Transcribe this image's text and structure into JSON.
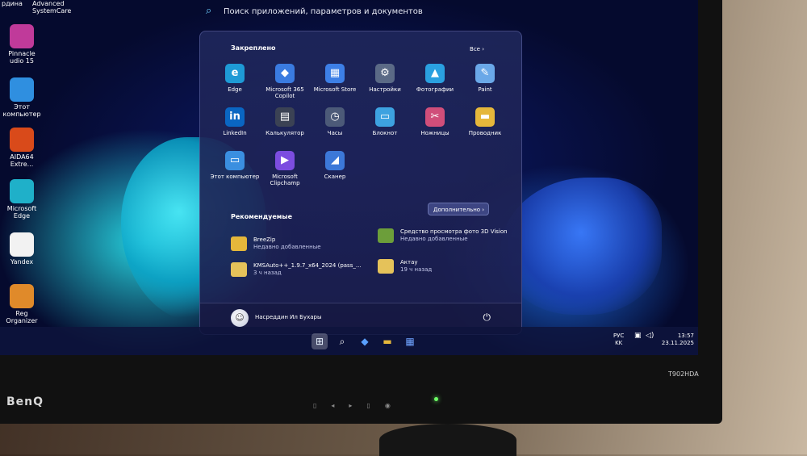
{
  "desktop": {
    "top_labels": [
      "рдина",
      "Advanced",
      "SystemCare"
    ],
    "icons": [
      {
        "label": "Pinnacle\nudio 15",
        "icon": "pinnacle-icon",
        "color": "#c03a9a"
      },
      {
        "label": "Этот\nкомпьютер",
        "icon": "computer-icon",
        "color": "#2f8fe0"
      },
      {
        "label": "AIDA64\nExtre...",
        "icon": "aida64-icon",
        "color": "#d94a1a"
      },
      {
        "label": "Microsoft\nEdge",
        "icon": "edge-icon",
        "color": "#1fb0c9"
      },
      {
        "label": "Yandex",
        "icon": "yandex-icon",
        "color": "#f2f2f2"
      },
      {
        "label": "Reg\nOrganizer",
        "icon": "reg-organizer-icon",
        "color": "#e08a2a"
      }
    ]
  },
  "search": {
    "placeholder": "Поиск приложений, параметров и документов"
  },
  "start_menu": {
    "pinned_title": "Закреплено",
    "all_label": "Все ›",
    "pinned": [
      {
        "label": "Edge",
        "icon": "edge-icon",
        "color": "#1e9ad6",
        "glyph": "e"
      },
      {
        "label": "Microsoft 365\nCopilot",
        "icon": "copilot-icon",
        "color": "#3a7be0",
        "glyph": "◆"
      },
      {
        "label": "Microsoft Store",
        "icon": "store-icon",
        "color": "#3d7fe6",
        "glyph": "▦"
      },
      {
        "label": "Настройки",
        "icon": "gear-icon",
        "color": "#5b6a86",
        "glyph": "⚙"
      },
      {
        "label": "Фотографии",
        "icon": "photos-icon",
        "color": "#2aa0e0",
        "glyph": "▲"
      },
      {
        "label": "Paint",
        "icon": "paint-icon",
        "color": "#6aa8e8",
        "glyph": "✎"
      },
      {
        "label": "LinkedIn",
        "icon": "linkedin-icon",
        "color": "#0a66c2",
        "glyph": "in"
      },
      {
        "label": "Калькулятор",
        "icon": "calculator-icon",
        "color": "#3b4254",
        "glyph": "▤"
      },
      {
        "label": "Часы",
        "icon": "clock-icon",
        "color": "#4c5a78",
        "glyph": "◷"
      },
      {
        "label": "Блокнот",
        "icon": "notepad-icon",
        "color": "#3da2e0",
        "glyph": "▭"
      },
      {
        "label": "Ножницы",
        "icon": "scissors-icon",
        "color": "#d04e7a",
        "glyph": "✂"
      },
      {
        "label": "Проводник",
        "icon": "folder-icon",
        "color": "#e5b73b",
        "glyph": "▬"
      },
      {
        "label": "Этот компьютер",
        "icon": "computer-icon",
        "color": "#3a8fe0",
        "glyph": "▭"
      },
      {
        "label": "Microsoft\nClipchamp",
        "icon": "clipchamp-icon",
        "color": "#7c4de0",
        "glyph": "▶"
      },
      {
        "label": "Сканер",
        "icon": "scanner-icon",
        "color": "#3c78d8",
        "glyph": "◢"
      }
    ],
    "recommended_title": "Рекомендуемые",
    "more_label": "Дополнительно ›",
    "recommended": [
      {
        "title": "BreeZip",
        "subtitle": "Недавно добавленные",
        "icon": "breezip-icon",
        "color": "#e5b73b"
      },
      {
        "title": "Средство просмотра фото 3D Vision",
        "subtitle": "Недавно добавленные",
        "icon": "3d-vision-icon",
        "color": "#6c9e3a"
      },
      {
        "title": "KMSAuto++_1.9.7_x64_2024 (pass_...",
        "subtitle": "3 ч назад",
        "icon": "folder-icon",
        "color": "#e5c25a"
      },
      {
        "title": "Актау",
        "subtitle": "19 ч назад",
        "icon": "folder-icon",
        "color": "#e5c25a"
      }
    ],
    "user_name": "Насреддин Ил Бухары"
  },
  "taskbar": {
    "buttons": [
      {
        "icon": "start-icon",
        "glyph": "⊞"
      },
      {
        "icon": "search-icon",
        "glyph": "⌕"
      },
      {
        "icon": "copilot-icon",
        "glyph": "◆"
      },
      {
        "icon": "file-explorer-icon",
        "glyph": "▬"
      },
      {
        "icon": "store-icon",
        "glyph": "▦"
      }
    ],
    "lang": "РУС\nKK",
    "time": "13:57",
    "date": "23.11.2025"
  },
  "monitor": {
    "brand": "BenQ",
    "model": "T902HDA"
  }
}
